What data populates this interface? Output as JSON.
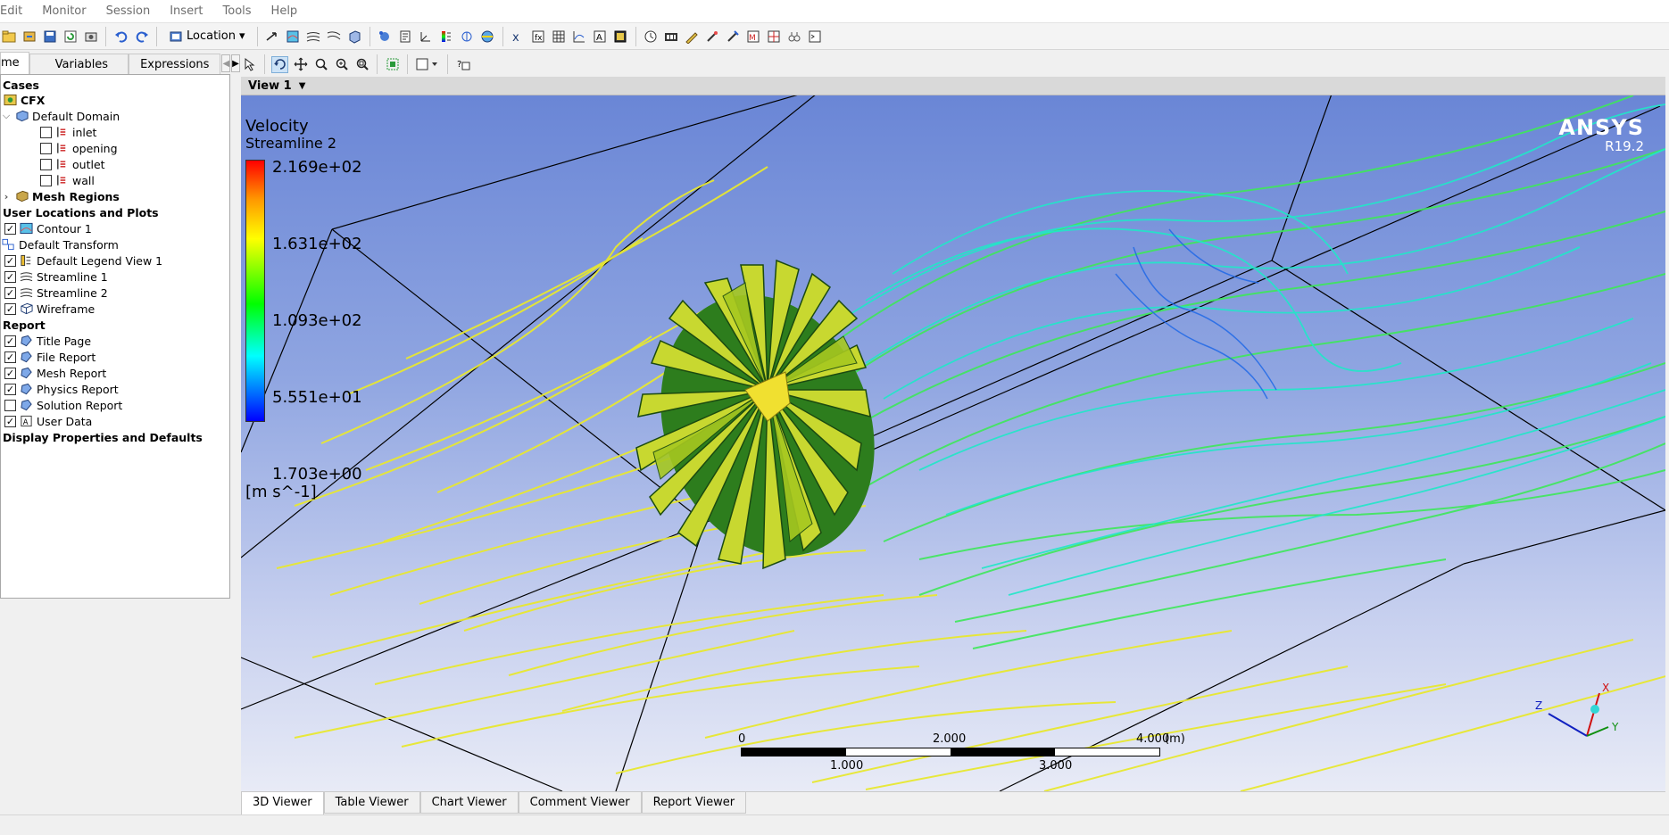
{
  "menu": [
    "Edit",
    "Monitor",
    "Session",
    "Insert",
    "Tools",
    "Help"
  ],
  "toolbar": {
    "location_label": "Location",
    "icons_group1": [
      "open-case-icon",
      "load-icon",
      "save-state-icon",
      "refresh-icon",
      "screenshot-icon"
    ],
    "icons_group2": [
      "undo-icon",
      "redo-icon"
    ],
    "icons_group3": [
      "vector-icon",
      "contour-icon",
      "streamline-icon",
      "particle-track-icon",
      "volume-rendering-icon",
      "isosurface-icon",
      "text-icon",
      "coordinate-frame-icon",
      "legend-icon",
      "instance-transform-icon",
      "clip-plane-icon",
      "color-map-icon",
      "variable-icon",
      "expression-icon",
      "table-icon",
      "chart-icon",
      "comment-icon",
      "figure-icon"
    ],
    "icons_group4": [
      "timestep-icon",
      "animation-icon",
      "quick-editor-icon",
      "probe-icon",
      "function-calculator-icon",
      "macro-calculator-icon",
      "mesh-calculator-icon",
      "case-comparison-icon",
      "command-editor-icon"
    ]
  },
  "left_tabs": {
    "tabs": [
      "me",
      "Variables",
      "Expressions"
    ]
  },
  "tree": {
    "cases_header": "Cases",
    "cfx": "CFX",
    "default_domain": "Default Domain",
    "domain_items": [
      "inlet",
      "opening",
      "outlet",
      "wall"
    ],
    "mesh_regions": "Mesh Regions",
    "user_locations_header": "User Locations and Plots",
    "contour": "Contour 1",
    "default_transform": "Default Transform",
    "default_legend": "Default Legend View 1",
    "streamline1": "Streamline 1",
    "streamline2": "Streamline 2",
    "wireframe": "Wireframe",
    "report_header": "Report",
    "report_items": [
      "Title Page",
      "File Report",
      "Mesh Report",
      "Physics Report",
      "Solution Report",
      "User Data"
    ],
    "display_props": "Display Properties and Defaults"
  },
  "view": {
    "title": "View 1"
  },
  "legend": {
    "variable": "Velocity",
    "plot": "Streamline 2",
    "values": [
      "2.169e+02",
      "1.631e+02",
      "1.093e+02",
      "5.551e+01",
      "1.703e+00"
    ],
    "unit": "[m s^-1]"
  },
  "logo": {
    "brand": "ANSYS",
    "version": "R19.2"
  },
  "scale_bar": {
    "top_labels": [
      "0",
      "2.000",
      "4.000"
    ],
    "bottom_labels": [
      "1.000",
      "3.000"
    ],
    "unit": "(m)"
  },
  "axes": {
    "x": "X",
    "y": "Y",
    "z": "Z"
  },
  "bottom_tabs": [
    "3D Viewer",
    "Table Viewer",
    "Chart Viewer",
    "Comment Viewer",
    "Report Viewer"
  ],
  "colors": {
    "legend_high": "#ff0000",
    "legend_low": "#0000ff",
    "background_top": "#6a86d6",
    "background_bottom": "#e8ebf6"
  }
}
